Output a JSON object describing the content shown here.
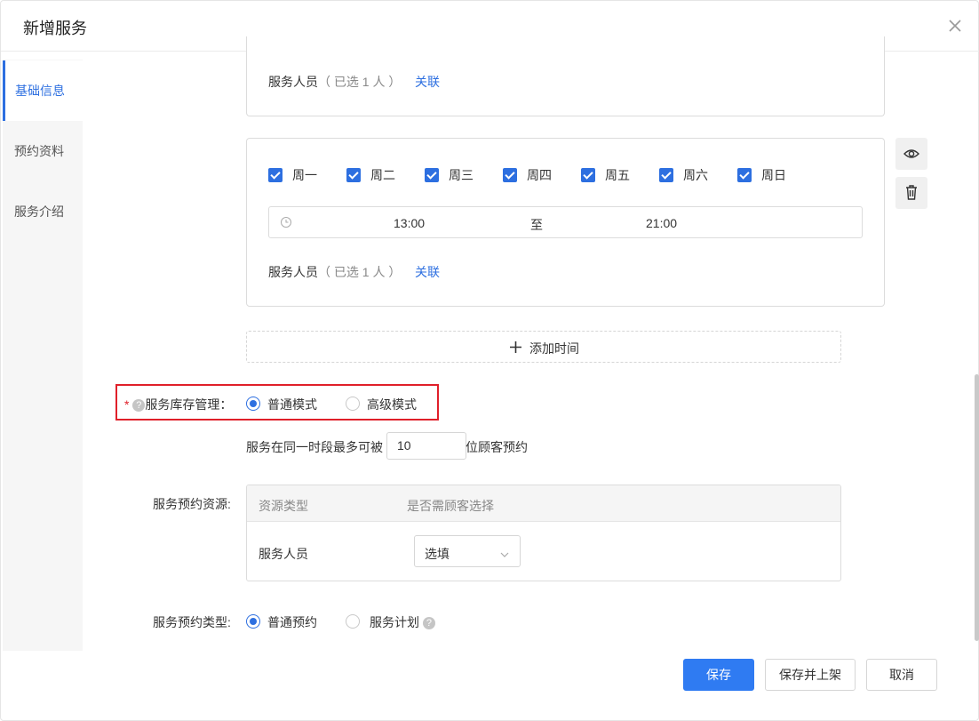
{
  "modal": {
    "title": "新增服务"
  },
  "sidebar": {
    "items": [
      {
        "label": "基础信息",
        "active": true
      },
      {
        "label": "预约资料",
        "active": false
      },
      {
        "label": "服务介绍",
        "active": false
      }
    ]
  },
  "time_slot_1": {
    "staff_label": "服务人员",
    "staff_selected": "（ 已选 1 人 ）",
    "link_label": "关联"
  },
  "time_slot_2": {
    "days": [
      "周一",
      "周二",
      "周三",
      "周四",
      "周五",
      "周六",
      "周日"
    ],
    "start_time": "13:00",
    "separator": "至",
    "end_time": "21:00",
    "staff_label": "服务人员",
    "staff_selected": "（ 已选 1 人 ）",
    "link_label": "关联",
    "icons": [
      "eye-icon",
      "trash-icon"
    ]
  },
  "add_time": {
    "label": "添加时间"
  },
  "inventory": {
    "required_mark": "*",
    "help_glyph": "?",
    "label": "服务库存管理：",
    "options": [
      "普通模式",
      "高级模式"
    ],
    "selected": "普通模式",
    "capacity_prefix": "服务在同一时段最多可被",
    "capacity_value": "10",
    "capacity_suffix": "位顾客预约"
  },
  "resources": {
    "label": "服务预约资源:",
    "columns": [
      "资源类型",
      "是否需顾客选择"
    ],
    "rows": [
      {
        "type": "服务人员",
        "choice": "选填"
      }
    ]
  },
  "booking_type": {
    "label": "服务预约类型:",
    "options": [
      "普通预约",
      "服务计划"
    ],
    "selected": "普通预约",
    "help_glyph": "?"
  },
  "footer": {
    "save": "保存",
    "save_publish": "保存并上架",
    "cancel": "取消"
  },
  "colors": {
    "primary": "#2f7bf2",
    "highlight_border": "#e0202a",
    "link": "#2d6fe0"
  }
}
